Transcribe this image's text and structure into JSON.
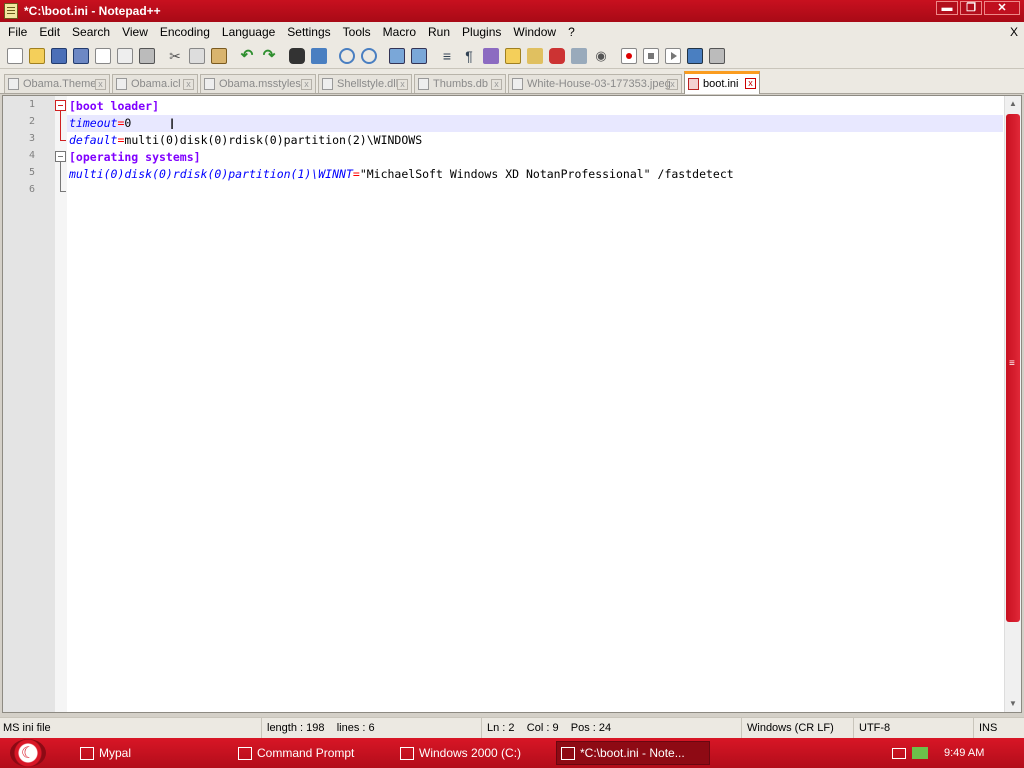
{
  "window": {
    "title": "*C:\\boot.ini - Notepad++",
    "buttons": {
      "minimize": "▬",
      "maximize": "❐",
      "close": "✕"
    }
  },
  "menubar": {
    "items": [
      "File",
      "Edit",
      "Search",
      "View",
      "Encoding",
      "Language",
      "Settings",
      "Tools",
      "Macro",
      "Run",
      "Plugins",
      "Window",
      "?"
    ],
    "doc_close": "X"
  },
  "toolbar": {
    "icons": [
      "new-file-icon",
      "open-file-icon",
      "save-icon",
      "save-all-icon",
      "close-file-icon",
      "close-all-icon",
      "print-icon",
      "cut-icon",
      "copy-icon",
      "paste-icon",
      "undo-icon",
      "redo-icon",
      "find-icon",
      "replace-icon",
      "zoom-in-icon",
      "zoom-out-icon",
      "sync-scroll-icon",
      "word-wrap-icon",
      "show-all-chars-icon",
      "indent-guide-icon",
      "user-defined-language-icon",
      "document-map-icon",
      "function-list-icon",
      "folder-monitor-icon",
      "eye-icon",
      "record-macro-icon",
      "stop-macro-icon",
      "play-macro-icon",
      "run-macro-multiple-icon",
      "save-macro-icon"
    ]
  },
  "tabs": [
    {
      "label": "Obama.Theme",
      "active": false
    },
    {
      "label": "Obama.icl",
      "active": false
    },
    {
      "label": "Obama.msstyles",
      "active": false
    },
    {
      "label": "Shellstyle.dll",
      "active": false
    },
    {
      "label": "Thumbs.db",
      "active": false
    },
    {
      "label": "White-House-03-177353.jpeg",
      "active": false
    },
    {
      "label": "boot.ini",
      "active": true
    }
  ],
  "editor": {
    "line_numbers": [
      "1",
      "2",
      "3",
      "4",
      "5",
      "6"
    ],
    "lines": [
      {
        "section": "[boot loader]"
      },
      {
        "key": "timeout",
        "eq": "=",
        "value": "0"
      },
      {
        "key": "default",
        "eq": "=",
        "value": "multi(0)disk(0)rdisk(0)partition(2)\\WINDOWS"
      },
      {
        "section": "[operating systems]"
      },
      {
        "key": "multi(0)disk(0)rdisk(0)partition(1)\\WINNT",
        "eq": "=",
        "value": "\"MichaelSoft Windows XD NotanProfessional\" /fastdetect"
      },
      {
        "value": ""
      }
    ],
    "current_line": 2
  },
  "statusbar": {
    "file_type": "MS ini file",
    "length": "length : 198",
    "lines": "lines : 6",
    "ln": "Ln : 2",
    "col": "Col : 9",
    "pos": "Pos : 24",
    "eol": "Windows (CR LF)",
    "encoding": "UTF-8",
    "mode": "INS"
  },
  "taskbar": {
    "tasks": [
      {
        "label": "Mypal",
        "icon": "mypal-icon",
        "active": false
      },
      {
        "label": "Command Prompt",
        "icon": "command-prompt-icon",
        "active": false
      },
      {
        "label": "Windows 2000 (C:)",
        "icon": "folder-icon",
        "active": false
      },
      {
        "label": "*C:\\boot.ini - Note...",
        "icon": "notepad-plus-plus-icon",
        "active": true
      }
    ],
    "clock": "9:49 AM"
  },
  "colors": {
    "title_bar": "#c8101f",
    "taskbar": "#d81626",
    "section": "#8000ff",
    "key": "#0000ff",
    "operator": "#ff0000",
    "active_tab_accent": "#fa9c1f",
    "current_line": "#e8e8ff"
  }
}
